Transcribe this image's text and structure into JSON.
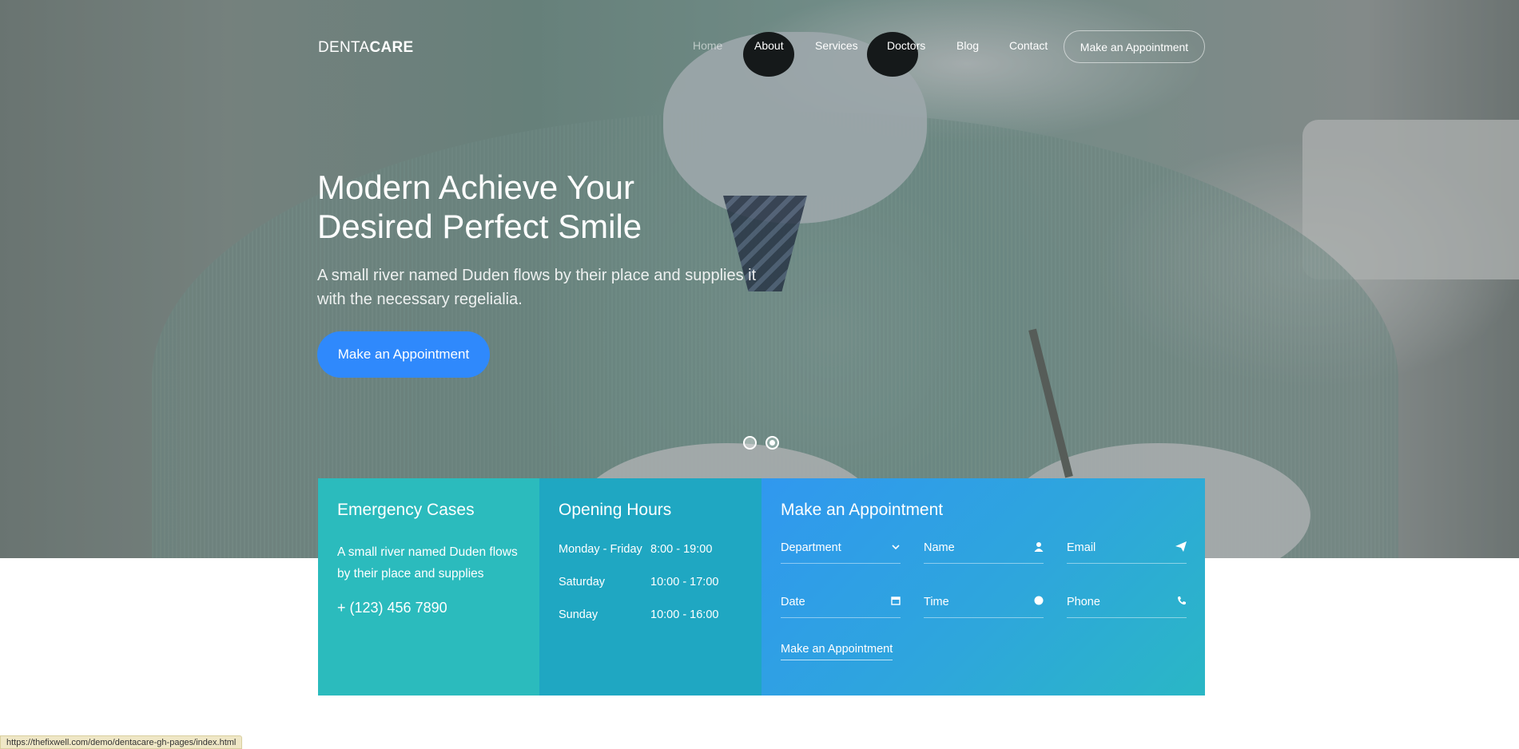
{
  "brand": {
    "light": "DENTA",
    "bold": "CARE"
  },
  "nav": {
    "items": [
      {
        "label": "Home",
        "active": true
      },
      {
        "label": "About"
      },
      {
        "label": "Services"
      },
      {
        "label": "Doctors"
      },
      {
        "label": "Blog"
      },
      {
        "label": "Contact"
      }
    ],
    "cta_label": "Make an Appointment"
  },
  "hero": {
    "title_line1": "Modern Achieve Your",
    "title_line2": "Desired Perfect Smile",
    "subtitle": "A small river named Duden flows by their place and supplies it with the necessary regelialia.",
    "button_label": "Make an Appointment",
    "slides": 2,
    "active_slide": 2
  },
  "emergency": {
    "title": "Emergency Cases",
    "text": "A small river named Duden flows by their place and supplies",
    "phone": "+ (123) 456 7890"
  },
  "hours": {
    "title": "Opening Hours",
    "rows": [
      {
        "day": "Monday - Friday",
        "time": "8:00 - 19:00"
      },
      {
        "day": "Saturday",
        "time": "10:00 - 17:00"
      },
      {
        "day": "Sunday",
        "time": "10:00 - 16:00"
      }
    ]
  },
  "appointment": {
    "title": "Make an Appointment",
    "fields": {
      "department": "Department",
      "name": "Name",
      "email": "Email",
      "date": "Date",
      "time": "Time",
      "phone": "Phone"
    },
    "submit_label": "Make an Appointment"
  },
  "status_url": "https://thefixwell.com/demo/dentacare-gh-pages/index.html",
  "colors": {
    "primary": "#2f89fc",
    "emergency_bg": "#2bbbbd",
    "hours_bg": "#1fa7c2",
    "appointment_bg": "#3098ef"
  }
}
